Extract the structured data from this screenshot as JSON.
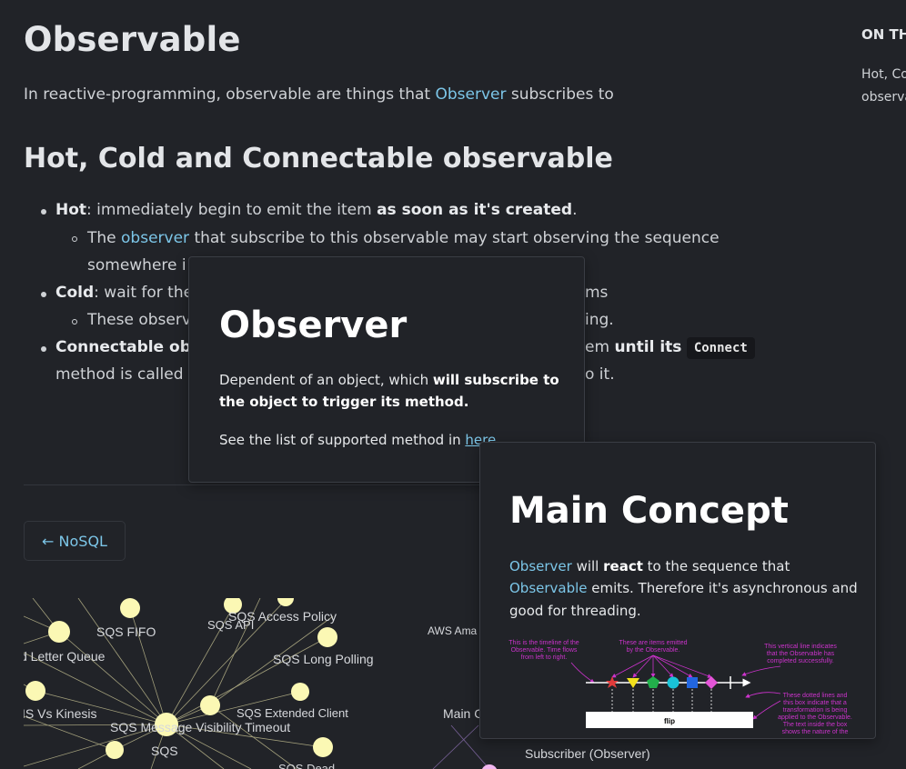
{
  "main": {
    "title": "Observable",
    "intro": {
      "before": "In reactive-programming, observable are things that ",
      "link": "Observer",
      "after": " subscribes to"
    },
    "section_title": "Hot, Cold and Connectable observable",
    "bullets": {
      "hot": {
        "label": "Hot",
        "text1": ": immediately begin to emit the item ",
        "bold": "as soon as it's created",
        "text2": "."
      },
      "hot_sub": {
        "before": "The ",
        "link": "observer",
        "after": " that subscribe to this observable may start observing the sequence",
        "line2": "somewhere i"
      },
      "cold": {
        "label": "Cold",
        "text": ": wait for the",
        "tail": "ms"
      },
      "cold_sub": {
        "text": "These observ",
        "tail": "ing."
      },
      "connectable": {
        "label": "Connectable obs",
        "tail": "em ",
        "bold": "until its",
        "code": "Connect",
        "line2": "method is called",
        "line2_tail": "o it."
      }
    },
    "prev_link": "← NoSQL"
  },
  "toc": {
    "title": "ON TH",
    "items": [
      "Hot, Co",
      "observa"
    ]
  },
  "graph": {
    "labels": [
      "SQS FIFO",
      "SQS API",
      "SQS Access Policy",
      "d Letter Queue",
      "SQS Long Polling",
      "AWS Ama",
      "IS Vs Kinesis",
      "SQS Extended Client",
      "SQS Message Visibility Timeout",
      "SQS",
      "SQS Dead",
      "Main C",
      "Subscriber (Observer)"
    ]
  },
  "popup_observer": {
    "title": "Observer",
    "line1_before": "Dependent of an object, which ",
    "line1_bold": "will subscribe to",
    "line2_bold": "the object to trigger its method.",
    "line3_before": "See the list of supported method in ",
    "line3_link": "here"
  },
  "popup_main": {
    "title": "Main Concept",
    "line1_link": "Observer",
    "line1_mid": " will ",
    "line1_bold": "react",
    "line1_after": " to the sequence that",
    "line2_link": "Observable",
    "line2_after": " emits. Therefore it's asynchronous and",
    "line3": "good for threading.",
    "diagram": {
      "note_timeline": [
        "This is the timeline of the",
        "Observable. Time flows",
        "from left to right."
      ],
      "note_items": [
        "These are items emitted",
        "by the Observable."
      ],
      "note_complete": [
        "This vertical line indicates",
        "that the Observable has",
        "completed successfully."
      ],
      "note_transform": [
        "These dotted lines and",
        "this box indicate that a",
        "transformation is being",
        "applied to the Observable.",
        "The text inside the box",
        "shows the nature of the"
      ],
      "operator": "flip",
      "annotation_color": "#cc33cc"
    }
  }
}
